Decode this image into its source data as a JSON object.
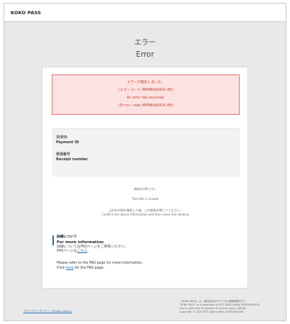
{
  "header": {
    "brand": "KOKO PASS"
  },
  "page": {
    "title_ja": "エラー",
    "title_en": "Error"
  },
  "error": {
    "line1": "エラーが発生しました。",
    "line2": "(エラーコード:MSFWOLW1014-00)",
    "line3": "An error has occurred.",
    "line4": "(Error code:MSFWOLW1014-00)"
  },
  "info": {
    "payment_label_ja": "決済ID",
    "payment_label_en": "Payment ID",
    "receipt_label_ja": "受領番号",
    "receipt_label_en": "Receipt number"
  },
  "messages": {
    "invalid_ja": "無効なURLです。",
    "invalid_en": "The URL is invalid.",
    "confirm_ja": "上記の内容を確認した後、この画面を閉じてください。",
    "confirm_en": "Confirm the above information and then close this window."
  },
  "detail": {
    "heading_ja": "詳細について",
    "heading_en": "For more information",
    "body_ja_1": "詳細についてはFAQページをご参照ください。",
    "body_ja_2_prefix": "FAQページは",
    "body_ja_2_link": "こちら",
    "body_ja_2_suffix": "。",
    "body_en_1": "Please refer to the FAQ page for more information.",
    "body_en_2_prefix": "Click ",
    "body_en_2_link": "here",
    "body_en_2_suffix": " for the FAQ page."
  },
  "footer": {
    "privacy_link": "プライバシーポリシー (Privacy policy)",
    "copy_1": "「KOKO PASS」は、株式会社NTTデータの登録商標です。",
    "copy_2": "\"KOKO PASS\" is a trademark of NTT DATA JAPAN CORPORATION",
    "copy_3": "and is valid with its product or service only in JAPAN.",
    "copy_4": "Copyright © 2023 NTT DATA JAPAN CORPORATION"
  },
  "colors": {
    "accent": "#2a6db0",
    "error_text": "#c0392b",
    "error_bg": "#fde2e2",
    "error_border": "#e07070"
  }
}
